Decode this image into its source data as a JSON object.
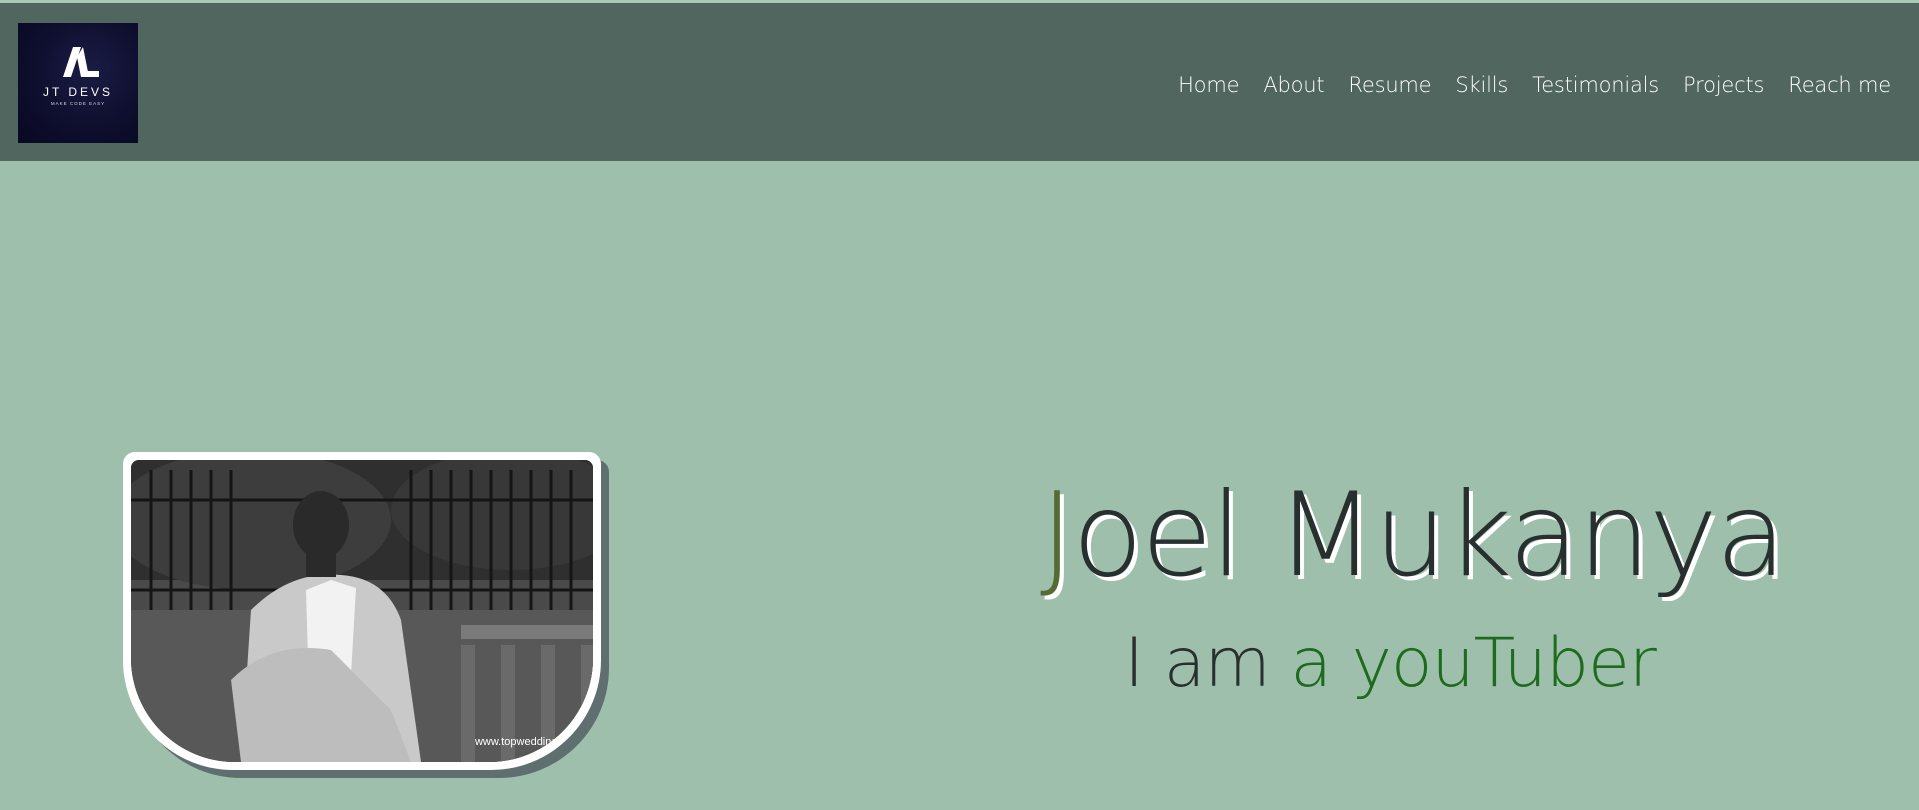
{
  "logo": {
    "title": "JT DEVS",
    "tagline": "MAKE CODE EASY",
    "icon": "jt-monogram-icon"
  },
  "nav": {
    "items": [
      {
        "label": "Home"
      },
      {
        "label": "About"
      },
      {
        "label": "Resume"
      },
      {
        "label": "Skills"
      },
      {
        "label": "Testimonials"
      },
      {
        "label": "Projects"
      },
      {
        "label": "Reach me"
      }
    ]
  },
  "hero": {
    "name_first_letter": "J",
    "name_rest": "oel Mukanya",
    "tagline_static": "I am",
    "tagline_dynamic": "a youTuber",
    "photo_watermark": "www.topweddings"
  },
  "colors": {
    "page_background": "#9ebfac",
    "header_background": "#50665f",
    "accent_letter": "#556b33",
    "tagline_accent": "#1e6b1e"
  }
}
